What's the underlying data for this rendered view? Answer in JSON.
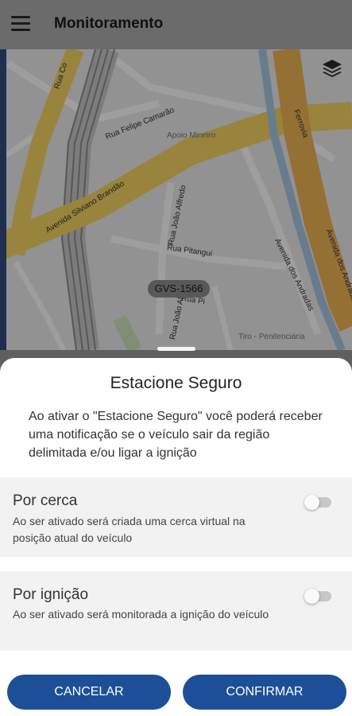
{
  "appbar": {
    "title": "Monitoramento",
    "menu_icon": "menu-icon"
  },
  "map": {
    "streets": [
      "Rua Felipe Camarão",
      "Avenida Silviano Brandão",
      "Rua João Alfredo",
      "Rua Pitangui",
      "Avenida dos Andradas",
      "Avenida dos Andradas",
      "Ferrovia",
      "Rua Co",
      "Rua Pi",
      "Rua João Al"
    ],
    "pois": [
      "Apoio Mineiro",
      "Tiro - Penitenciária"
    ],
    "vehicle_plate": "GVS-1566",
    "layers_icon": "layers-icon"
  },
  "sheet": {
    "title": "Estacione Seguro",
    "description": "Ao ativar o \"Estacione Seguro\" você poderá receber uma notificação se o veículo sair da região delimitada e/ou ligar a ignição",
    "options": [
      {
        "title": "Por cerca",
        "description": "Ao ser ativado será criada uma cerca virtual na posição atual do veículo",
        "enabled": false
      },
      {
        "title": "Por ignição",
        "description": "Ao ser ativado será monitorada a ignição do veículo",
        "enabled": false
      }
    ],
    "cancel_label": "CANCELAR",
    "confirm_label": "CONFIRMAR"
  },
  "colors": {
    "primary": "#1d4f99",
    "road_yellow": "#f5d563",
    "road_orange": "#f0b554"
  }
}
